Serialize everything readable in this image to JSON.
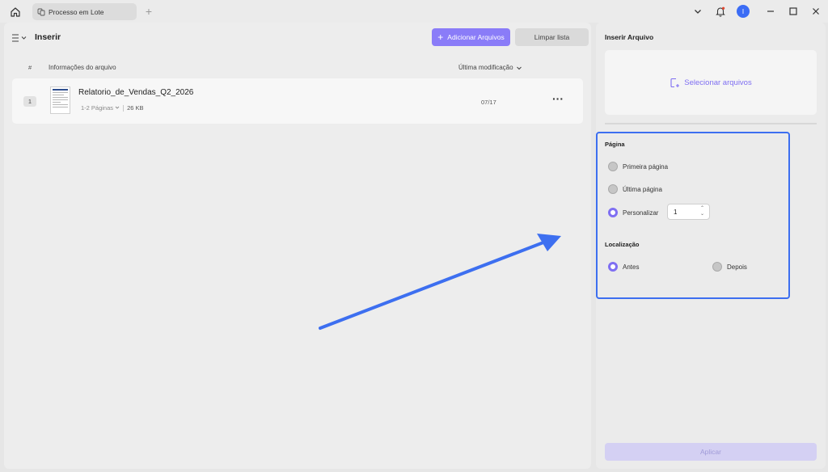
{
  "tabs": [
    {
      "label": "Processo em Lote"
    }
  ],
  "left": {
    "title": "Inserir",
    "add_button": "Adicionar Arquivos",
    "clear_button": "Limpar lista",
    "columns": {
      "num": "#",
      "info": "Informações do arquivo",
      "modified": "Última modificação"
    },
    "files": [
      {
        "index": "1",
        "name": "Relatorio_de_Vendas_Q2_2026",
        "pages": "1-2 Páginas",
        "size": "26 KB",
        "date": "07/17"
      }
    ]
  },
  "right": {
    "title": "Inserir Arquivo",
    "select_files": "Selecionar arquivos",
    "page_section": "Página",
    "page_options": [
      "Primeira página",
      "Última página",
      "Personalizar"
    ],
    "page_selected": "Personalizar",
    "custom_page_value": "1",
    "location_section": "Localização",
    "location_options": [
      "Antes",
      "Depois"
    ],
    "location_selected": "Antes",
    "apply": "Aplicar"
  },
  "user": {
    "avatar_initial": "I"
  },
  "colors": {
    "accent": "#7f6ff2",
    "highlight": "#3d6ff0",
    "avatar": "#3b6cf5"
  }
}
